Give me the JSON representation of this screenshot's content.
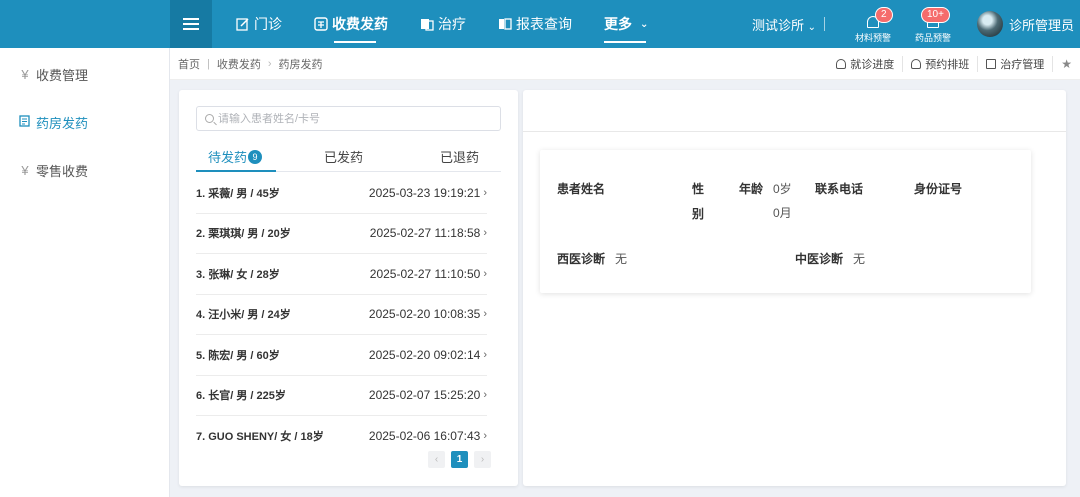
{
  "nav": {
    "items": [
      {
        "label": "门诊"
      },
      {
        "label": "收费发药"
      },
      {
        "label": "治疗"
      },
      {
        "label": "报表查询"
      },
      {
        "label": "更多"
      }
    ],
    "clinic": "测试诊所",
    "alerts": [
      {
        "label": "材料预警",
        "count": "2"
      },
      {
        "label": "药品预警",
        "count": "10+"
      }
    ],
    "user": "诊所管理员"
  },
  "sidebar": {
    "items": [
      {
        "label": "收费管理",
        "icon": "yen-icon"
      },
      {
        "label": "药房发药",
        "icon": "prescription-icon"
      },
      {
        "label": "零售收费",
        "icon": "yen-icon"
      }
    ]
  },
  "breadcrumb": [
    "首页",
    "收费发药",
    "药房发药"
  ],
  "quick_links": [
    "就诊进度",
    "预约排班",
    "治疗管理"
  ],
  "search": {
    "placeholder": "请输入患者姓名/卡号"
  },
  "tabs": [
    {
      "label": "待发药",
      "count": "9"
    },
    {
      "label": "已发药"
    },
    {
      "label": "已退药"
    }
  ],
  "patients": [
    {
      "name": "1. 采薇/ 男 / 45岁",
      "time": "2025-03-23 19:19:21"
    },
    {
      "name": "2. 栗琪琪/ 男 / 20岁",
      "time": "2025-02-27 11:18:58"
    },
    {
      "name": "3. 张琳/ 女 / 28岁",
      "time": "2025-02-27 11:10:50"
    },
    {
      "name": "4. 汪小米/ 男 / 24岁",
      "time": "2025-02-20 10:08:35"
    },
    {
      "name": "5. 陈宏/ 男 / 60岁",
      "time": "2025-02-20 09:02:14"
    },
    {
      "name": "6. 长官/ 男 / 225岁",
      "time": "2025-02-07 15:25:20"
    },
    {
      "name": "7. GUO SHENY/ 女 / 18岁",
      "time": "2025-02-06 16:07:43"
    }
  ],
  "pager": {
    "current": "1"
  },
  "detail": {
    "name_label": "患者姓名",
    "gender_label_1": "性",
    "gender_label_2": "别",
    "age_label": "年龄",
    "age_value_1": "0岁",
    "age_value_2": "0月",
    "phone_label": "联系电话",
    "id_label": "身份证号",
    "western_label": "西医诊断",
    "western_value": "无",
    "tcm_label": "中医诊断",
    "tcm_value": "无"
  },
  "colors": {
    "primary": "#1e8fbd",
    "badge": "#f56c6c"
  }
}
